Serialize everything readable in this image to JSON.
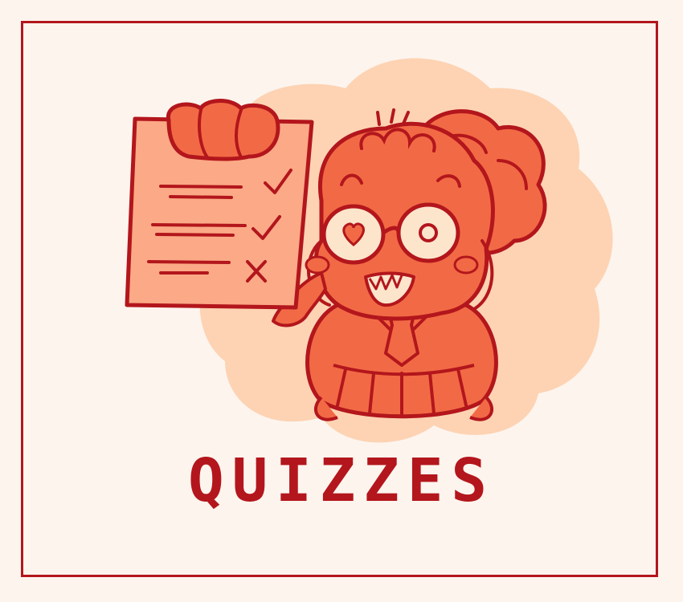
{
  "title": "QUIZZES",
  "colors": {
    "background": "#fdf4ee",
    "frame": "#b3161c",
    "line": "#b3161c",
    "character": "#f26a45",
    "paper": "#fba986",
    "blob": "#fdd3b3",
    "glasses_fill": "#fde5cc"
  },
  "icons": {
    "paper": "quiz-paper-icon",
    "check": "checkmark-icon",
    "cross": "x-mark-icon",
    "heart": "heart-eye-icon"
  }
}
